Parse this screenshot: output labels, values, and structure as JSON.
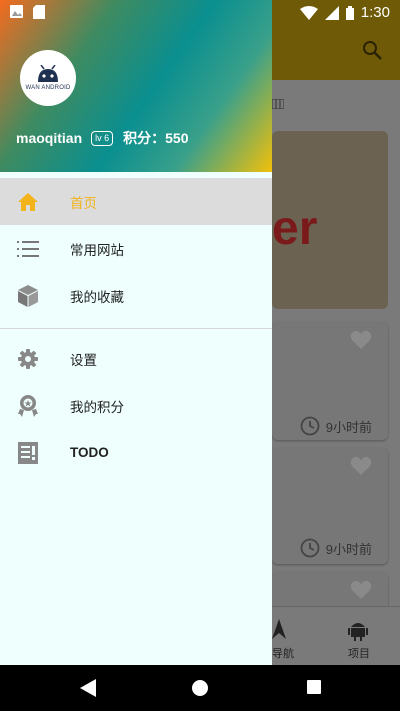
{
  "status_bar": {
    "time": "1:30"
  },
  "background": {
    "banner_text": "er",
    "cards": [
      {
        "time": "9小时前"
      },
      {
        "time": "9小时前"
      }
    ],
    "bottom_nav": [
      {
        "label": "导航"
      },
      {
        "label": "项目"
      }
    ]
  },
  "drawer": {
    "avatar_text": "WAN ANDROID",
    "username": "maoqitian",
    "level": "lv 6",
    "points": "积分：550",
    "menu": [
      {
        "label": "首页",
        "icon": "home-icon"
      },
      {
        "label": "常用网站",
        "icon": "list-icon"
      },
      {
        "label": "我的收藏",
        "icon": "cube-icon"
      },
      {
        "label": "设置",
        "icon": "gear-icon"
      },
      {
        "label": "我的积分",
        "icon": "award-icon"
      },
      {
        "label": "TODO",
        "icon": "todo-icon"
      }
    ]
  },
  "colors": {
    "accent": "#f2b31b",
    "drawer_bg": "#eefffe",
    "active_bg": "#dcdcdc"
  }
}
